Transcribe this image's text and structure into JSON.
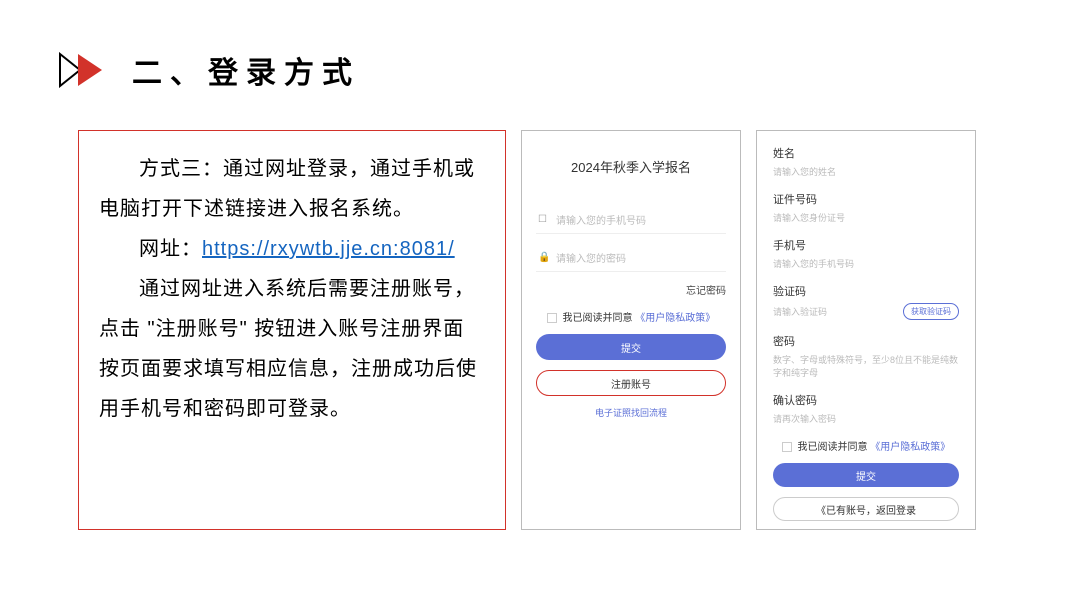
{
  "header": {
    "title": "二、登录方式"
  },
  "desc": {
    "line1_a": "方式三：通过网址登录，通过手机或电脑打开下述链接进入报名系统。",
    "line2_label": "网址：",
    "line2_url": "https://rxywtb.jje.cn:8081/",
    "line3": "通过网址进入系统后需要注册账号，点击 \"注册账号\" 按钮进入账号注册界面按页面要求填写相应信息，注册成功后使用手机号和密码即可登录。"
  },
  "login": {
    "title": "2024年秋季入学报名",
    "phone_ph": "请输入您的手机号码",
    "pwd_ph": "请输入您的密码",
    "forgot": "忘记密码",
    "policy_text": "我已阅读并同意",
    "policy_link": "《用户隐私政策》",
    "submit": "提交",
    "register": "注册账号",
    "cert_link": "电子证照找回流程"
  },
  "register": {
    "name_label": "姓名",
    "name_ph": "请输入您的姓名",
    "id_label": "证件号码",
    "id_ph": "请输入您身份证号",
    "phone_label": "手机号",
    "phone_ph": "请输入您的手机号码",
    "code_label": "验证码",
    "code_ph": "请输入验证码",
    "code_btn": "获取验证码",
    "pwd_label": "密码",
    "pwd_ph": "数字、字母或特殊符号，至少8位且不能是纯数字和纯字母",
    "pwd2_label": "确认密码",
    "pwd2_ph": "请再次输入密码",
    "policy_text": "我已阅读并同意",
    "policy_link": "《用户隐私政策》",
    "submit": "提交",
    "back": "《已有账号，返回登录"
  }
}
